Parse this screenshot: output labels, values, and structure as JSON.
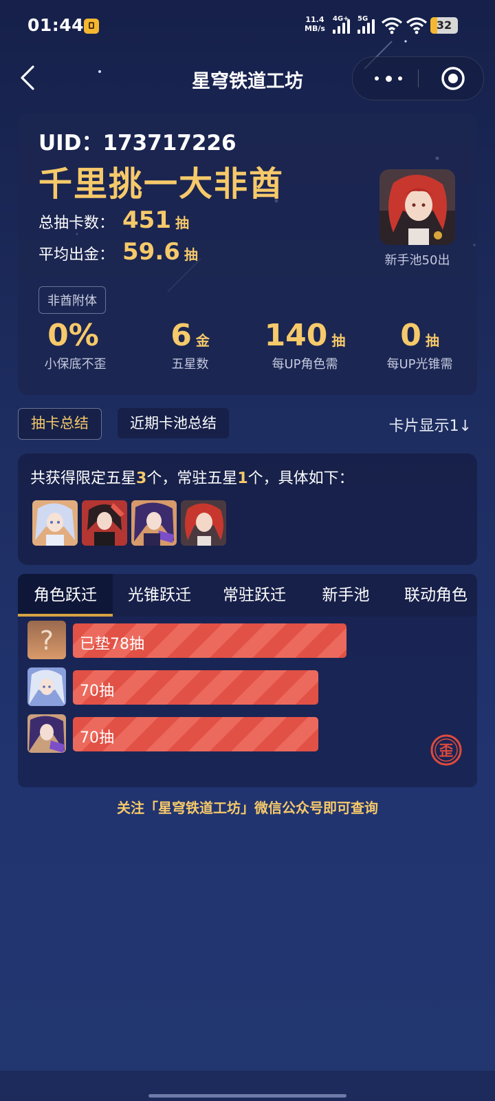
{
  "status_bar": {
    "time": "01:44",
    "speed_value": "11.4",
    "speed_unit": "MB/s",
    "net1": "4G+",
    "net2": "5G",
    "battery": "32"
  },
  "nav": {
    "title": "星穹铁道工坊"
  },
  "profile": {
    "uid": "UID：173717226",
    "rank_title": "千里挑一大非酋",
    "total_label": "总抽卡数：",
    "total_value": "451",
    "total_unit": "抽",
    "avg_label": "平均出金：",
    "avg_value": "59.6",
    "avg_unit": "抽",
    "tag": "非酋附体",
    "avatar_caption": "新手池50出"
  },
  "metrics": [
    {
      "value": "0%",
      "unit": "",
      "label": "小保底不歪"
    },
    {
      "value": "6",
      "unit": "金",
      "label": "五星数"
    },
    {
      "value": "140",
      "unit": "抽",
      "label": "每UP角色需"
    },
    {
      "value": "0",
      "unit": "抽",
      "label": "每UP光锥需"
    }
  ],
  "summary_tabs": {
    "tab1": "抽卡总结",
    "tab2": "近期卡池总结",
    "card_display": "卡片显示1↓"
  },
  "summary": {
    "prefix": "共获得限定五星",
    "limited_count": "3",
    "middle": "个，常驻五星",
    "standard_count": "1",
    "suffix": "个，具体如下："
  },
  "pool_tabs": [
    "角色跃迁",
    "光锥跃迁",
    "常驻跃迁",
    "新手池",
    "联动角色"
  ],
  "pulls": [
    {
      "label": "已垫78抽",
      "value": 78,
      "avatar": "unknown"
    },
    {
      "label": "70抽",
      "value": 70,
      "avatar": "character"
    },
    {
      "label": "70抽",
      "value": 70,
      "avatar": "character",
      "badge": "歪"
    }
  ],
  "footer": "关注「星穹铁道工坊」微信公众号即可查询",
  "colors": {
    "accent_gold": "#f6c96a",
    "bar_red": "#e25145"
  }
}
